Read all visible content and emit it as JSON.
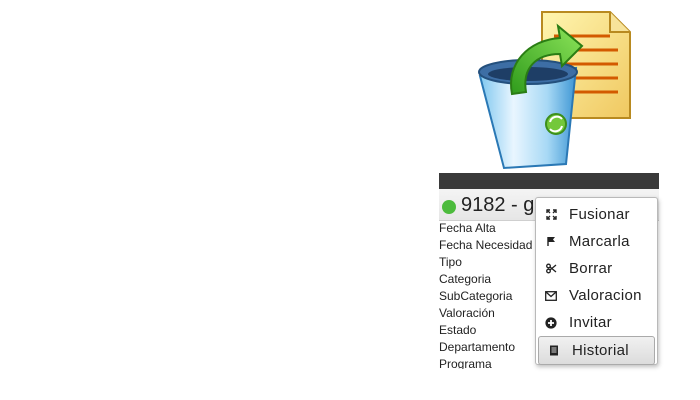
{
  "ticket": {
    "title": "9182 - gg",
    "status_color": "#4cbb3c"
  },
  "fields": [
    "Fecha Alta",
    "Fecha Necesidad",
    "Tipo",
    "Categoria",
    "SubCategoria",
    "Valoración",
    "Estado",
    "Departamento",
    "Programa"
  ],
  "context_menu": {
    "items": [
      {
        "label": "Fusionar",
        "icon": "expand-icon"
      },
      {
        "label": "Marcarla",
        "icon": "flag-icon"
      },
      {
        "label": "Borrar",
        "icon": "scissors-icon"
      },
      {
        "label": "Valoracion",
        "icon": "envelope-icon"
      },
      {
        "label": "Invitar",
        "icon": "plus-circle-icon"
      },
      {
        "label": "Historial",
        "icon": "book-icon"
      }
    ],
    "hovered": "Historial"
  },
  "colors": {
    "header_bar": "#3a3a3a",
    "status_green": "#4cbb3c"
  }
}
